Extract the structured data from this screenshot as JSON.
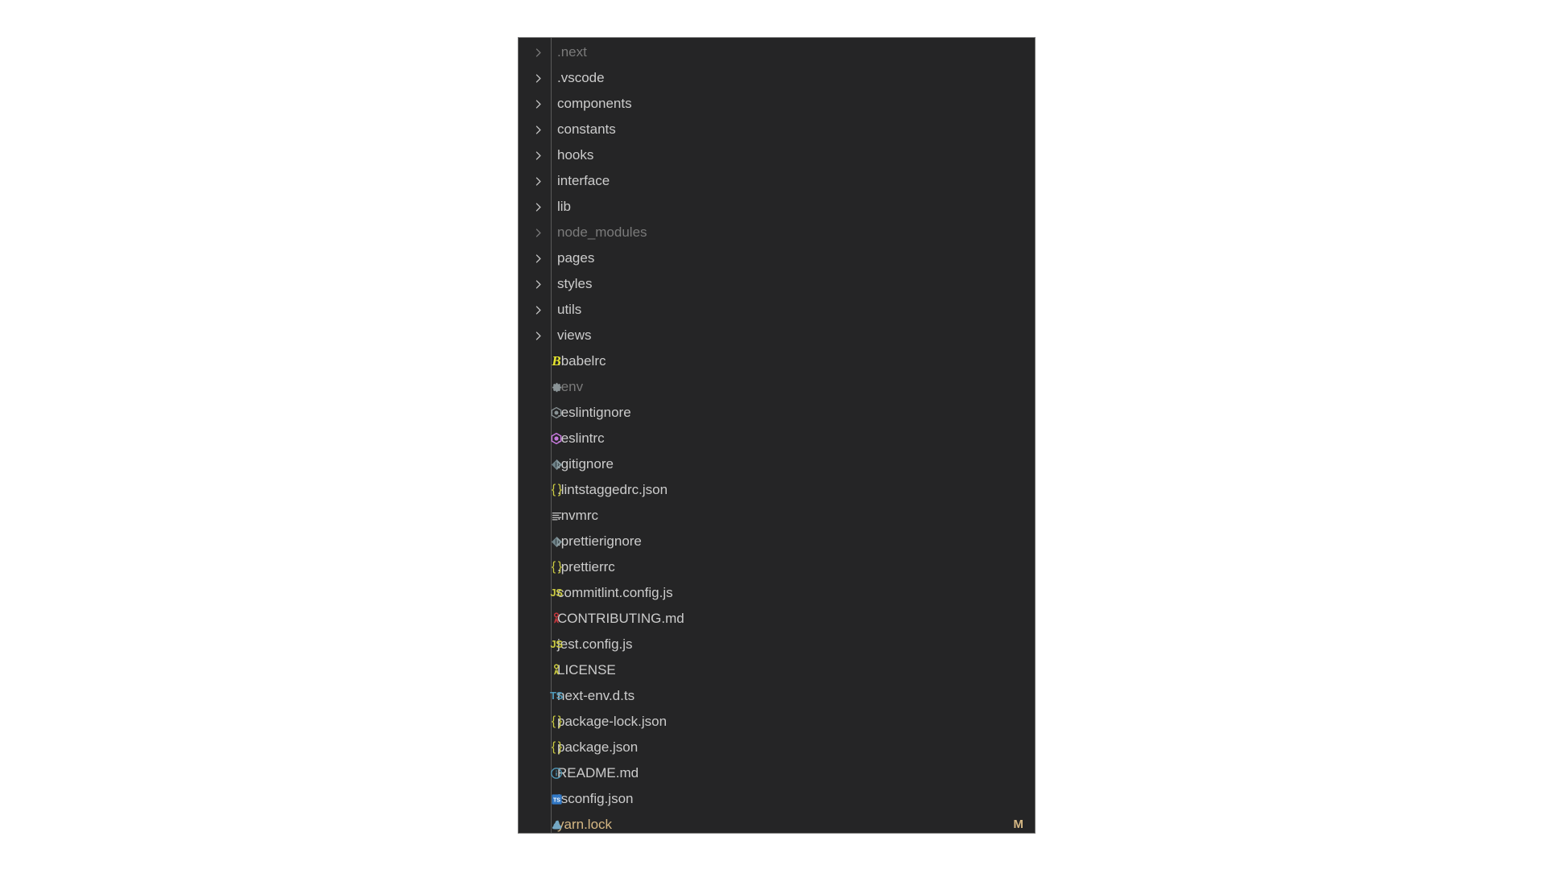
{
  "explorer": {
    "panel_name": "file-explorer-tree",
    "background_color": "#252526",
    "text_color": "#cccccc",
    "dim_color": "#7a7a7a",
    "modified_color": "#d6b884",
    "items": [
      {
        "label": ".next",
        "kind": "folder",
        "icon": "chevron-right-icon",
        "state": "collapsed",
        "dim": true
      },
      {
        "label": ".vscode",
        "kind": "folder",
        "icon": "chevron-right-icon",
        "state": "collapsed",
        "dim": false
      },
      {
        "label": "components",
        "kind": "folder",
        "icon": "chevron-right-icon",
        "state": "collapsed",
        "dim": false
      },
      {
        "label": "constants",
        "kind": "folder",
        "icon": "chevron-right-icon",
        "state": "collapsed",
        "dim": false
      },
      {
        "label": "hooks",
        "kind": "folder",
        "icon": "chevron-right-icon",
        "state": "collapsed",
        "dim": false
      },
      {
        "label": "interface",
        "kind": "folder",
        "icon": "chevron-right-icon",
        "state": "collapsed",
        "dim": false
      },
      {
        "label": "lib",
        "kind": "folder",
        "icon": "chevron-right-icon",
        "state": "collapsed",
        "dim": false
      },
      {
        "label": "node_modules",
        "kind": "folder",
        "icon": "chevron-right-icon",
        "state": "collapsed",
        "dim": true
      },
      {
        "label": "pages",
        "kind": "folder",
        "icon": "chevron-right-icon",
        "state": "collapsed",
        "dim": false
      },
      {
        "label": "styles",
        "kind": "folder",
        "icon": "chevron-right-icon",
        "state": "collapsed",
        "dim": false
      },
      {
        "label": "utils",
        "kind": "folder",
        "icon": "chevron-right-icon",
        "state": "collapsed",
        "dim": false
      },
      {
        "label": "views",
        "kind": "folder",
        "icon": "chevron-right-icon",
        "state": "collapsed",
        "dim": false
      },
      {
        "label": ".babelrc",
        "kind": "file",
        "icon": "babel-icon",
        "dim": false
      },
      {
        "label": ".env",
        "kind": "file",
        "icon": "gear-icon",
        "dim": true
      },
      {
        "label": ".eslintignore",
        "kind": "file",
        "icon": "eslint-gray-icon",
        "dim": false
      },
      {
        "label": ".eslintrc",
        "kind": "file",
        "icon": "eslint-icon",
        "dim": false
      },
      {
        "label": ".gitignore",
        "kind": "file",
        "icon": "git-icon",
        "dim": false
      },
      {
        "label": ".lintstaggedrc.json",
        "kind": "file",
        "icon": "json-braces-icon",
        "dim": false
      },
      {
        "label": ".nvmrc",
        "kind": "file",
        "icon": "text-lines-icon",
        "dim": false
      },
      {
        "label": ".prettierignore",
        "kind": "file",
        "icon": "git-icon",
        "dim": false
      },
      {
        "label": ".prettierrc",
        "kind": "file",
        "icon": "json-braces-icon",
        "dim": false
      },
      {
        "label": "commitlint.config.js",
        "kind": "file",
        "icon": "js-icon",
        "dim": false
      },
      {
        "label": "CONTRIBUTING.md",
        "kind": "file",
        "icon": "contributing-icon",
        "dim": false
      },
      {
        "label": "jest.config.js",
        "kind": "file",
        "icon": "js-icon",
        "dim": false
      },
      {
        "label": "LICENSE",
        "kind": "file",
        "icon": "license-icon",
        "dim": false
      },
      {
        "label": "next-env.d.ts",
        "kind": "file",
        "icon": "ts-icon",
        "dim": false
      },
      {
        "label": "package-lock.json",
        "kind": "file",
        "icon": "json-braces-icon",
        "dim": false
      },
      {
        "label": "package.json",
        "kind": "file",
        "icon": "json-braces-icon",
        "dim": false
      },
      {
        "label": "README.md",
        "kind": "file",
        "icon": "info-circle-icon",
        "dim": false
      },
      {
        "label": "tsconfig.json",
        "kind": "file",
        "icon": "tsconfig-icon",
        "dim": false
      },
      {
        "label": "yarn.lock",
        "kind": "file",
        "icon": "yarn-icon",
        "dim": false,
        "status": "M",
        "modified": true
      }
    ]
  }
}
